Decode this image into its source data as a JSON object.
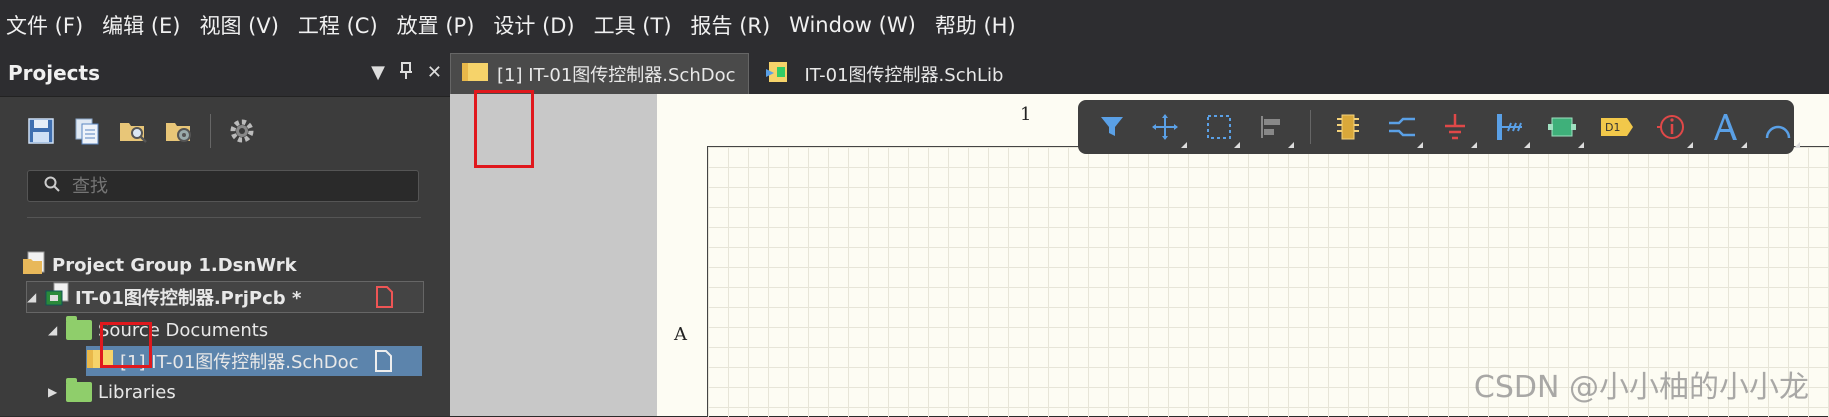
{
  "menu": {
    "items": [
      "文件 (F)",
      "编辑 (E)",
      "视图 (V)",
      "工程 (C)",
      "放置 (P)",
      "设计 (D)",
      "工具 (T)",
      "报告 (R)",
      "Window (W)",
      "帮助 (H)"
    ]
  },
  "projects_panel": {
    "title": "Projects",
    "search_placeholder": "查找",
    "tree": {
      "group": "Project Group 1.DsnWrk",
      "project": "IT-01图传控制器.PrjPcb *",
      "source_folder": "Source Documents",
      "schdoc": "[1] IT-01图传控制器.SchDoc",
      "libraries": "Libraries"
    }
  },
  "tabs": [
    {
      "label": "[1] IT-01图传控制器.SchDoc",
      "active": true
    },
    {
      "label": "IT-01图传控制器.SchLib",
      "active": false
    }
  ],
  "sheet": {
    "zone_column": "1",
    "zone_row": "A"
  },
  "watermark": "CSDN @小小柚的小小龙",
  "colors": {
    "highlight_box": "#e0181d",
    "selection": "#5c84ac",
    "folder": "#8fce6b",
    "toolbar_icon_blue": "#5aa0e6"
  },
  "icons": {
    "panel_toolbar": [
      "save-icon",
      "copy-doc-icon",
      "folder-search-icon",
      "folder-gear-icon",
      "settings-gear-icon"
    ],
    "floating_toolbar": [
      "filter-icon",
      "move-icon",
      "select-rect-icon",
      "align-icon",
      "component-icon",
      "wire-icon",
      "ground-icon",
      "bus-icon",
      "sheet-symbol-icon",
      "designator-icon",
      "parameter-icon",
      "text-icon",
      "arc-icon"
    ]
  }
}
